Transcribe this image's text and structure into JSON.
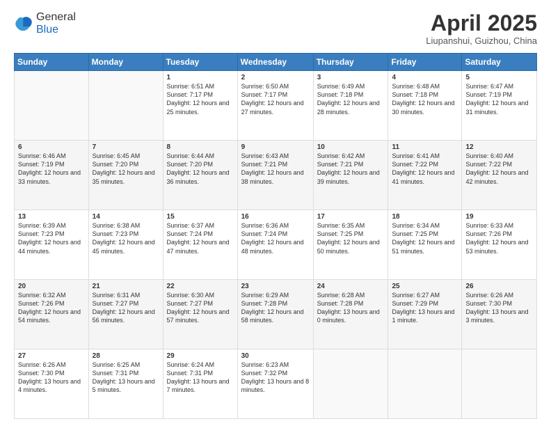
{
  "header": {
    "logo_general": "General",
    "logo_blue": "Blue",
    "month": "April 2025",
    "location": "Liupanshui, Guizhou, China"
  },
  "weekdays": [
    "Sunday",
    "Monday",
    "Tuesday",
    "Wednesday",
    "Thursday",
    "Friday",
    "Saturday"
  ],
  "weeks": [
    [
      {
        "day": "",
        "info": ""
      },
      {
        "day": "",
        "info": ""
      },
      {
        "day": "1",
        "info": "Sunrise: 6:51 AM\nSunset: 7:17 PM\nDaylight: 12 hours and 25 minutes."
      },
      {
        "day": "2",
        "info": "Sunrise: 6:50 AM\nSunset: 7:17 PM\nDaylight: 12 hours and 27 minutes."
      },
      {
        "day": "3",
        "info": "Sunrise: 6:49 AM\nSunset: 7:18 PM\nDaylight: 12 hours and 28 minutes."
      },
      {
        "day": "4",
        "info": "Sunrise: 6:48 AM\nSunset: 7:18 PM\nDaylight: 12 hours and 30 minutes."
      },
      {
        "day": "5",
        "info": "Sunrise: 6:47 AM\nSunset: 7:19 PM\nDaylight: 12 hours and 31 minutes."
      }
    ],
    [
      {
        "day": "6",
        "info": "Sunrise: 6:46 AM\nSunset: 7:19 PM\nDaylight: 12 hours and 33 minutes."
      },
      {
        "day": "7",
        "info": "Sunrise: 6:45 AM\nSunset: 7:20 PM\nDaylight: 12 hours and 35 minutes."
      },
      {
        "day": "8",
        "info": "Sunrise: 6:44 AM\nSunset: 7:20 PM\nDaylight: 12 hours and 36 minutes."
      },
      {
        "day": "9",
        "info": "Sunrise: 6:43 AM\nSunset: 7:21 PM\nDaylight: 12 hours and 38 minutes."
      },
      {
        "day": "10",
        "info": "Sunrise: 6:42 AM\nSunset: 7:21 PM\nDaylight: 12 hours and 39 minutes."
      },
      {
        "day": "11",
        "info": "Sunrise: 6:41 AM\nSunset: 7:22 PM\nDaylight: 12 hours and 41 minutes."
      },
      {
        "day": "12",
        "info": "Sunrise: 6:40 AM\nSunset: 7:22 PM\nDaylight: 12 hours and 42 minutes."
      }
    ],
    [
      {
        "day": "13",
        "info": "Sunrise: 6:39 AM\nSunset: 7:23 PM\nDaylight: 12 hours and 44 minutes."
      },
      {
        "day": "14",
        "info": "Sunrise: 6:38 AM\nSunset: 7:23 PM\nDaylight: 12 hours and 45 minutes."
      },
      {
        "day": "15",
        "info": "Sunrise: 6:37 AM\nSunset: 7:24 PM\nDaylight: 12 hours and 47 minutes."
      },
      {
        "day": "16",
        "info": "Sunrise: 6:36 AM\nSunset: 7:24 PM\nDaylight: 12 hours and 48 minutes."
      },
      {
        "day": "17",
        "info": "Sunrise: 6:35 AM\nSunset: 7:25 PM\nDaylight: 12 hours and 50 minutes."
      },
      {
        "day": "18",
        "info": "Sunrise: 6:34 AM\nSunset: 7:25 PM\nDaylight: 12 hours and 51 minutes."
      },
      {
        "day": "19",
        "info": "Sunrise: 6:33 AM\nSunset: 7:26 PM\nDaylight: 12 hours and 53 minutes."
      }
    ],
    [
      {
        "day": "20",
        "info": "Sunrise: 6:32 AM\nSunset: 7:26 PM\nDaylight: 12 hours and 54 minutes."
      },
      {
        "day": "21",
        "info": "Sunrise: 6:31 AM\nSunset: 7:27 PM\nDaylight: 12 hours and 56 minutes."
      },
      {
        "day": "22",
        "info": "Sunrise: 6:30 AM\nSunset: 7:27 PM\nDaylight: 12 hours and 57 minutes."
      },
      {
        "day": "23",
        "info": "Sunrise: 6:29 AM\nSunset: 7:28 PM\nDaylight: 12 hours and 58 minutes."
      },
      {
        "day": "24",
        "info": "Sunrise: 6:28 AM\nSunset: 7:28 PM\nDaylight: 13 hours and 0 minutes."
      },
      {
        "day": "25",
        "info": "Sunrise: 6:27 AM\nSunset: 7:29 PM\nDaylight: 13 hours and 1 minute."
      },
      {
        "day": "26",
        "info": "Sunrise: 6:26 AM\nSunset: 7:30 PM\nDaylight: 13 hours and 3 minutes."
      }
    ],
    [
      {
        "day": "27",
        "info": "Sunrise: 6:26 AM\nSunset: 7:30 PM\nDaylight: 13 hours and 4 minutes."
      },
      {
        "day": "28",
        "info": "Sunrise: 6:25 AM\nSunset: 7:31 PM\nDaylight: 13 hours and 5 minutes."
      },
      {
        "day": "29",
        "info": "Sunrise: 6:24 AM\nSunset: 7:31 PM\nDaylight: 13 hours and 7 minutes."
      },
      {
        "day": "30",
        "info": "Sunrise: 6:23 AM\nSunset: 7:32 PM\nDaylight: 13 hours and 8 minutes."
      },
      {
        "day": "",
        "info": ""
      },
      {
        "day": "",
        "info": ""
      },
      {
        "day": "",
        "info": ""
      }
    ]
  ]
}
